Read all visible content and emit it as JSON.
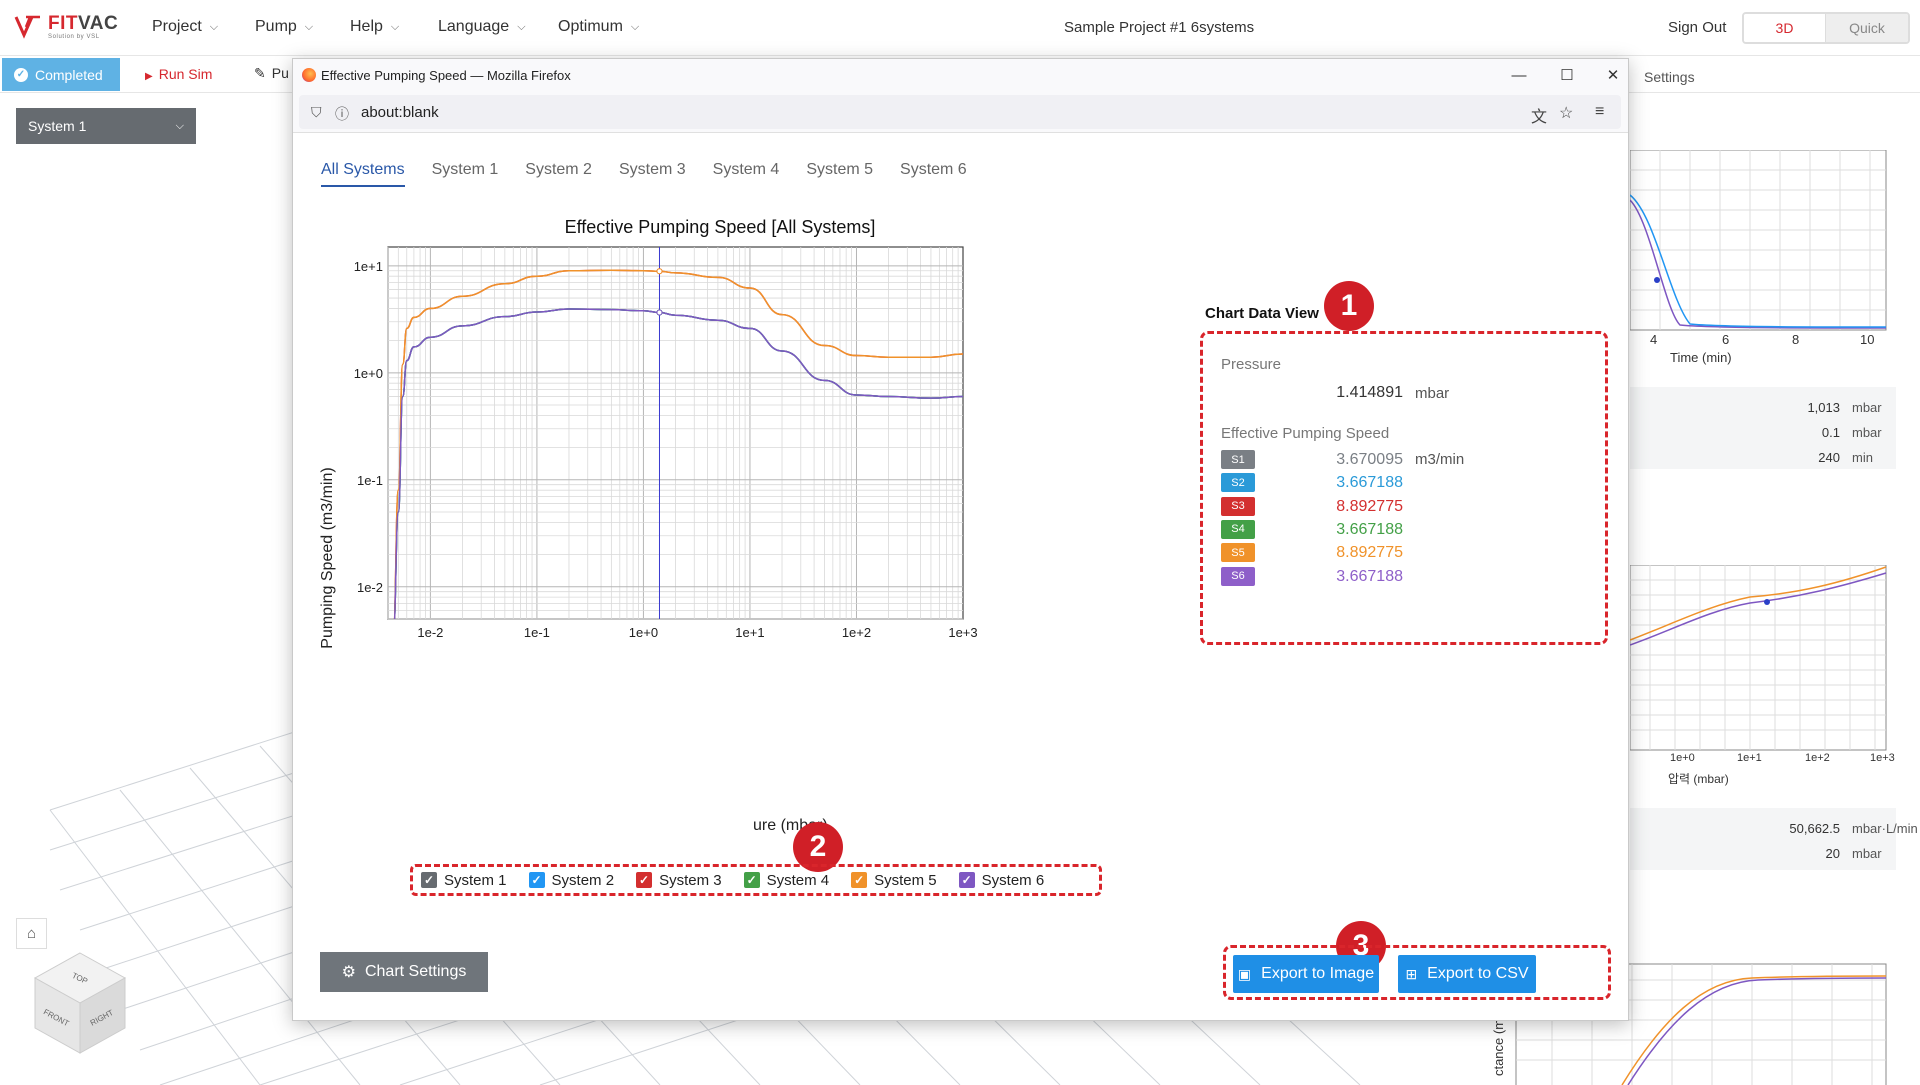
{
  "app": {
    "logo_main_a": "FIT",
    "logo_main_b": "VAC",
    "logo_sub": "Solution by VSL",
    "menus": [
      "Project",
      "Pump",
      "Help",
      "Language",
      "Optimum"
    ],
    "project_title": "Sample Project #1 6systems",
    "sign_out": "Sign Out",
    "mode_3d": "3D",
    "mode_quick": "Quick"
  },
  "toolbar": {
    "completed": "Completed",
    "run_sim": "Run Sim",
    "pu": "Pu",
    "settings": "Settings"
  },
  "left_panel": {
    "system_select": "System 1",
    "cube_top": "TOP",
    "cube_front": "FRONT",
    "cube_right": "RIGHT"
  },
  "background_panel": {
    "chart1_xticks": [
      "4",
      "6",
      "8",
      "10"
    ],
    "chart1_xlabel": "Time (min)",
    "rows1": [
      {
        "value": "1,013",
        "unit": "mbar"
      },
      {
        "value": "0.1",
        "unit": "mbar"
      },
      {
        "value": "240",
        "unit": "min"
      }
    ],
    "chart2_xticks": [
      "1e+0",
      "1e+1",
      "1e+2",
      "1e+3"
    ],
    "chart2_xlabel": "압력 (mbar)",
    "rows2": [
      {
        "value": "50,662.5",
        "unit": "mbar·L/min"
      },
      {
        "value": "20",
        "unit": "mbar"
      }
    ],
    "chart3_ylabel": "ctance (m"
  },
  "browser": {
    "title": "Effective Pumping Speed — Mozilla Firefox",
    "url": "about:blank"
  },
  "tabs": [
    "All Systems",
    "System 1",
    "System 2",
    "System 3",
    "System 4",
    "System 5",
    "System 6"
  ],
  "chart_data": {
    "type": "line",
    "title": "Effective Pumping Speed [All Systems]",
    "subtitle": "Sample Project #1 6systems",
    "xlabel": "ure (mbar)",
    "ylabel": "Pumping Speed (m3/min)",
    "x_scale": "log",
    "y_scale": "log",
    "xlim": [
      0.004,
      1000
    ],
    "ylim": [
      0.005,
      15
    ],
    "x_ticks": [
      "1e-2",
      "1e-1",
      "1e+0",
      "1e+1",
      "1e+2",
      "1e+3"
    ],
    "y_ticks": [
      "1e+1",
      "1e+0",
      "1e-1",
      "1e-2"
    ],
    "grid": true,
    "cursor_x": 1.414891,
    "series": [
      {
        "name": "System 1",
        "color": "#666b70",
        "x": [
          0.0045,
          0.005,
          0.0055,
          0.006,
          0.007,
          0.01,
          0.02,
          0.05,
          0.1,
          0.2,
          0.5,
          1.0,
          1.414891,
          2,
          5,
          10,
          20,
          50,
          100,
          200,
          500,
          1000
        ],
        "y": [
          0.004,
          0.05,
          0.6,
          1.3,
          1.75,
          2.15,
          2.75,
          3.35,
          3.7,
          3.95,
          3.9,
          3.8,
          3.670095,
          3.45,
          3.1,
          2.6,
          1.6,
          0.85,
          0.62,
          0.6,
          0.58,
          0.6
        ]
      },
      {
        "name": "System 2",
        "color": "#2196f3",
        "x": [
          0.0045,
          0.005,
          0.0055,
          0.006,
          0.007,
          0.01,
          0.02,
          0.05,
          0.1,
          0.2,
          0.5,
          1.0,
          1.414891,
          2,
          5,
          10,
          20,
          50,
          100,
          200,
          500,
          1000
        ],
        "y": [
          0.004,
          0.05,
          0.6,
          1.3,
          1.75,
          2.15,
          2.75,
          3.35,
          3.7,
          3.95,
          3.9,
          3.8,
          3.667188,
          3.45,
          3.1,
          2.6,
          1.6,
          0.85,
          0.62,
          0.6,
          0.58,
          0.6
        ]
      },
      {
        "name": "System 3",
        "color": "#d32f2f",
        "x": [
          0.0045,
          0.005,
          0.0055,
          0.006,
          0.007,
          0.01,
          0.02,
          0.05,
          0.1,
          0.2,
          0.5,
          1.0,
          1.414891,
          2,
          5,
          10,
          20,
          50,
          100,
          200,
          500,
          1000
        ],
        "y": [
          0.004,
          0.08,
          1.2,
          2.6,
          3.3,
          4.0,
          5.2,
          6.8,
          8.0,
          9.0,
          9.1,
          9.0,
          8.892775,
          8.6,
          7.8,
          6.2,
          3.5,
          1.8,
          1.45,
          1.4,
          1.4,
          1.5
        ]
      },
      {
        "name": "System 4",
        "color": "#43a047",
        "x": [
          0.0045,
          0.005,
          0.0055,
          0.006,
          0.007,
          0.01,
          0.02,
          0.05,
          0.1,
          0.2,
          0.5,
          1.0,
          1.414891,
          2,
          5,
          10,
          20,
          50,
          100,
          200,
          500,
          1000
        ],
        "y": [
          0.004,
          0.05,
          0.6,
          1.3,
          1.75,
          2.15,
          2.75,
          3.35,
          3.7,
          3.95,
          3.9,
          3.8,
          3.667188,
          3.45,
          3.1,
          2.6,
          1.6,
          0.85,
          0.62,
          0.6,
          0.58,
          0.6
        ]
      },
      {
        "name": "System 5",
        "color": "#f0922a",
        "x": [
          0.0045,
          0.005,
          0.0055,
          0.006,
          0.007,
          0.01,
          0.02,
          0.05,
          0.1,
          0.2,
          0.5,
          1.0,
          1.414891,
          2,
          5,
          10,
          20,
          50,
          100,
          200,
          500,
          1000
        ],
        "y": [
          0.004,
          0.08,
          1.2,
          2.6,
          3.3,
          4.0,
          5.2,
          6.8,
          8.0,
          9.0,
          9.1,
          9.0,
          8.892775,
          8.6,
          7.8,
          6.2,
          3.5,
          1.8,
          1.45,
          1.4,
          1.4,
          1.5
        ]
      },
      {
        "name": "System 6",
        "color": "#7e57c2",
        "x": [
          0.0045,
          0.005,
          0.0055,
          0.006,
          0.007,
          0.01,
          0.02,
          0.05,
          0.1,
          0.2,
          0.5,
          1.0,
          1.414891,
          2,
          5,
          10,
          20,
          50,
          100,
          200,
          500,
          1000
        ],
        "y": [
          0.004,
          0.05,
          0.6,
          1.3,
          1.75,
          2.15,
          2.75,
          3.35,
          3.7,
          3.95,
          3.9,
          3.8,
          3.667188,
          3.45,
          3.1,
          2.6,
          1.6,
          0.85,
          0.62,
          0.6,
          0.58,
          0.6
        ]
      }
    ]
  },
  "legend": [
    {
      "label": "System 1",
      "color": "#666b70"
    },
    {
      "label": "System 2",
      "color": "#2196f3"
    },
    {
      "label": "System 3",
      "color": "#d32f2f"
    },
    {
      "label": "System 4",
      "color": "#43a047"
    },
    {
      "label": "System 5",
      "color": "#f0922a"
    },
    {
      "label": "System 6",
      "color": "#7e57c2"
    }
  ],
  "chart_data_view": {
    "title": "Chart Data View",
    "pressure_label": "Pressure",
    "pressure_value": "1.414891",
    "pressure_unit": "mbar",
    "speed_label": "Effective Pumping Speed",
    "speed_unit": "m3/min",
    "rows": [
      {
        "badge": "S1",
        "value": "3.670095",
        "color": "#7a7f85"
      },
      {
        "badge": "S2",
        "value": "3.667188",
        "color": "#2a9ad8"
      },
      {
        "badge": "S3",
        "value": "8.892775",
        "color": "#d32f2f"
      },
      {
        "badge": "S4",
        "value": "3.667188",
        "color": "#43a047"
      },
      {
        "badge": "S5",
        "value": "8.892775",
        "color": "#f0922a"
      },
      {
        "badge": "S6",
        "value": "3.667188",
        "color": "#8e5fc9"
      }
    ]
  },
  "annotations": [
    "1",
    "2",
    "3"
  ],
  "buttons": {
    "chart_settings": "Chart Settings",
    "export_image": "Export to Image",
    "export_csv": "Export to CSV"
  }
}
